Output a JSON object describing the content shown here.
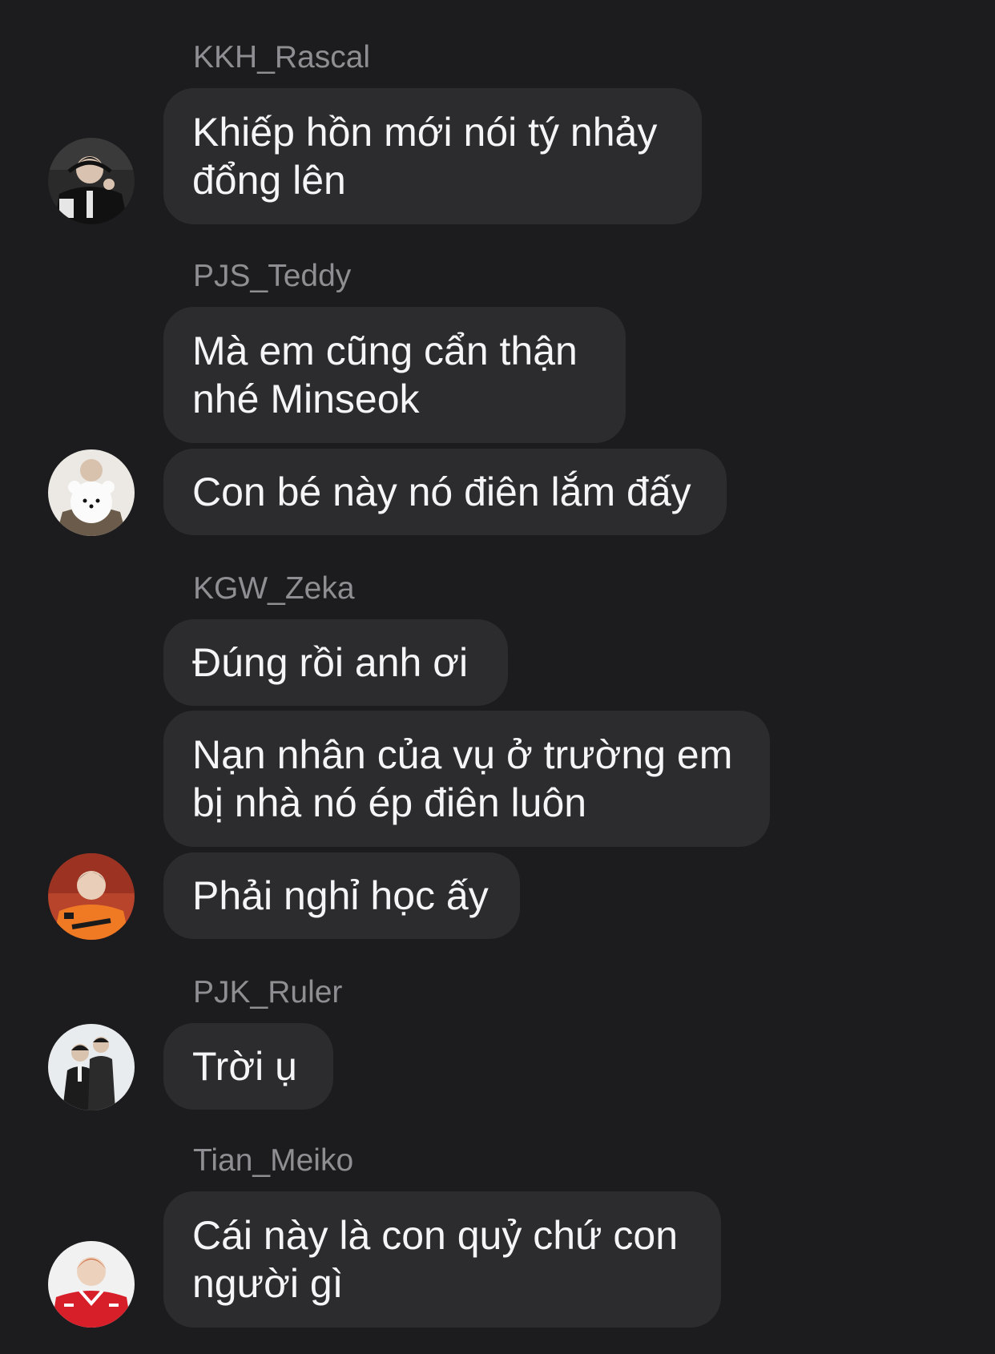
{
  "chat": {
    "groups": [
      {
        "sender": "KKH_Rascal",
        "avatar_icon": "user-avatar-dark-jersey",
        "messages": [
          "Khiếp hồn mới nói tý nhảy\nđổng lên"
        ]
      },
      {
        "sender": "PJS_Teddy",
        "avatar_icon": "user-avatar-white-plush",
        "messages": [
          "Mà em cũng cẩn thận\nnhé Minseok",
          "Con bé này nó điên lắm đấy"
        ]
      },
      {
        "sender": "KGW_Zeka",
        "avatar_icon": "user-avatar-orange-jersey",
        "messages": [
          "Đúng rồi anh ơi",
          "Nạn nhân của vụ ở trường em\nbị nhà nó ép điên luôn",
          "Phải nghỉ học ấy"
        ]
      },
      {
        "sender": "PJK_Ruler",
        "avatar_icon": "user-avatar-black-suit",
        "messages": [
          "Trời ụ"
        ]
      },
      {
        "sender": "Tian_Meiko",
        "avatar_icon": "user-avatar-red-jersey",
        "messages": [
          "Cái này là con quỷ chứ con\nngười gì"
        ]
      }
    ]
  },
  "colors": {
    "background": "#1c1c1e",
    "bubble": "#2c2c2e",
    "sender_name": "#8e8e93",
    "message_text": "#f5f5f7"
  }
}
